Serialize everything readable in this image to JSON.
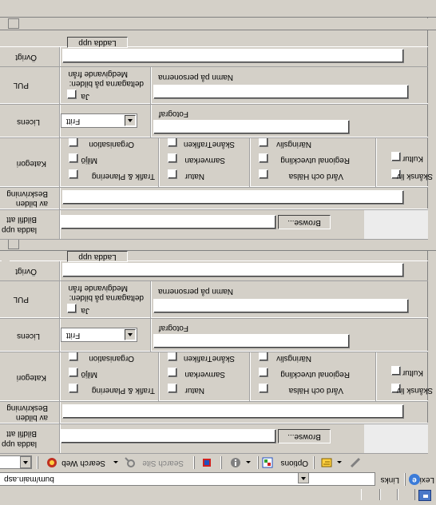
{
  "window": {
    "address": "bum/main.asp",
    "links_label": "Links",
    "lexi_label": "Lexi"
  },
  "toolbar": {
    "search_web": "Search Web",
    "search_site": "Search Site",
    "options": "Options"
  },
  "form_block": {
    "upload_label_1": "Bildfil att",
    "upload_label_2": "ladda upp",
    "browse_button": "Browse...",
    "description_label_1": "Beskrivning",
    "description_label_2": "av bilden",
    "category_label": "Kategori",
    "categories": {
      "col1": [
        "Trafik & Planering",
        "Miljö",
        "Organisation"
      ],
      "col2": [
        "Natur",
        "Samverkan",
        "SkåneTrafiken"
      ],
      "col3": [
        "Vård och Hälsa",
        "Regional utveckling",
        "Näringsliv"
      ],
      "col4": [
        "Skånsk liv",
        "Kultur"
      ]
    },
    "license_label": "Licens",
    "license_value": "Fritt",
    "photographer_label": "Fotograf",
    "pul_label": "PUL",
    "consent_label_1": "Medgivande från",
    "consent_label_2": "deltagarna på bilden:",
    "consent_yes": "Ja",
    "names_label": "Namn på personerna",
    "other_label": "Övrigt",
    "upload_button": "Ladda upp"
  }
}
